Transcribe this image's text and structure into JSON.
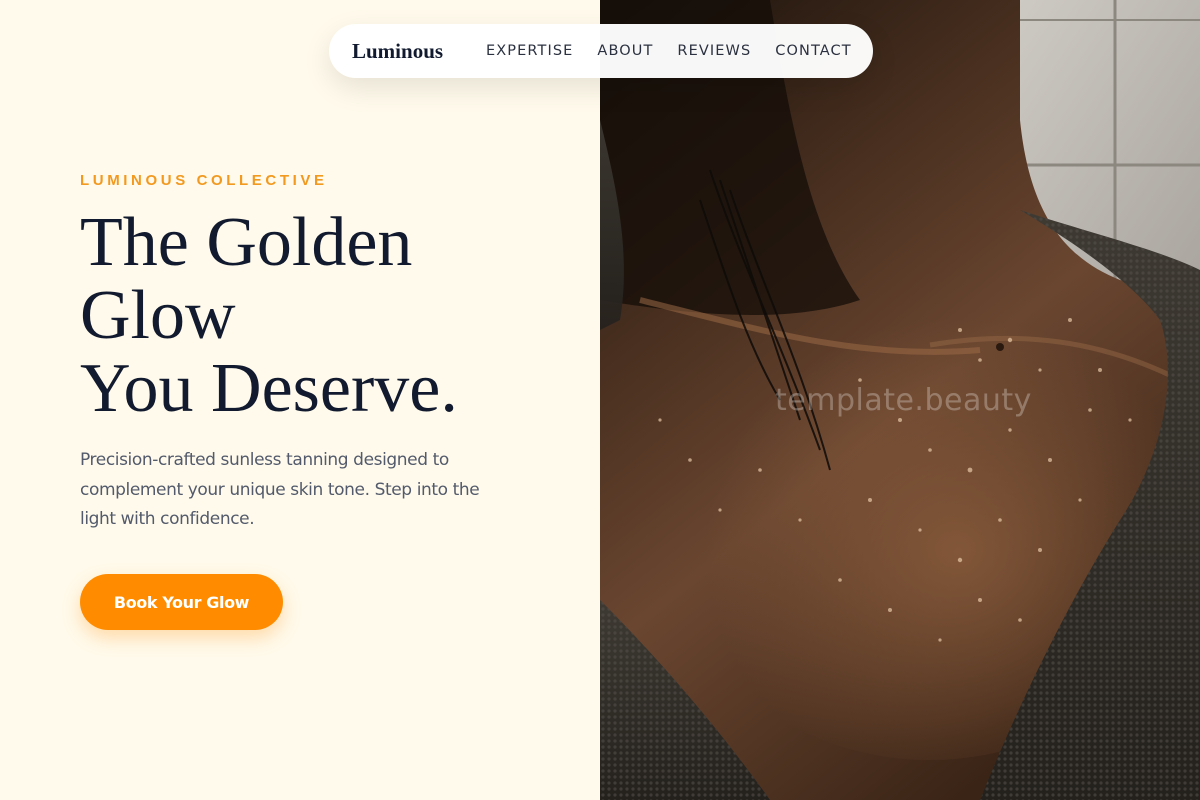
{
  "nav": {
    "brand": "Luminous",
    "links": [
      "EXPERTISE",
      "ABOUT",
      "REVIEWS",
      "CONTACT"
    ]
  },
  "hero": {
    "eyebrow": "LUMINOUS COLLECTIVE",
    "headline": [
      "The Golden",
      "Glow",
      "You Deserve."
    ],
    "description": "Precision-crafted sunless tanning designed to complement your unique skin tone. Step into the light with confidence.",
    "cta_label": "Book Your Glow"
  },
  "image": {
    "watermark": "template.beauty",
    "subject": "close-up of a woman's neck and collarbone with water droplets, wearing a dark terry robe"
  },
  "colors": {
    "accent": "#ff8c00",
    "eyebrow": "#f2991f",
    "heading": "#111a2e",
    "body_text": "#525a6b",
    "background": "#fffaeb"
  }
}
